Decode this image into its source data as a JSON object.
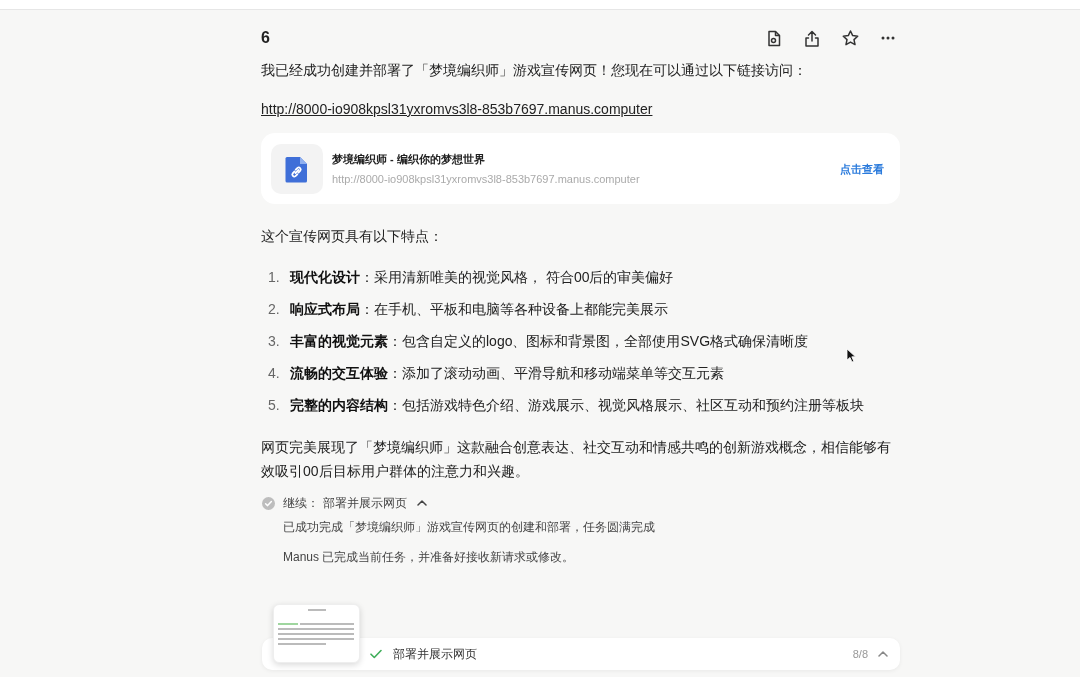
{
  "message": {
    "title": "6",
    "intro": "我已经成功创建并部署了「梦境编织师」游戏宣传网页！您现在可以通过以下链接访问：",
    "link": "http://8000-io908kpsl31yxromvs3l8-853b7697.manus.computer"
  },
  "link_card": {
    "title": "梦境编织师 - 编织你的梦想世界",
    "url": "http://8000-io908kpsl31yxromvs3l8-853b7697.manus.computer",
    "action": "点击查看"
  },
  "features_heading": "这个宣传网页具有以下特点：",
  "features": [
    {
      "number": "1.",
      "text": "**现代化设计**：采用清新唯美的视觉风格， 符合00后的审美偏好"
    },
    {
      "number": "2.",
      "text": "**响应式布局**：在手机、平板和电脑等各种设备上都能完美展示"
    },
    {
      "number": "3.",
      "text": "**丰富的视觉元素**：包含自定义的logo、图标和背景图，全部使用SVG格式确保清晰度"
    },
    {
      "number": "4.",
      "text": "**流畅的交互体验**：添加了滚动动画、平滑导航和移动端菜单等交互元素"
    },
    {
      "number": "5.",
      "text": "**完整的内容结构**：包括游戏特色介绍、游戏展示、视觉风格展示、社区互动和预约注册等板块"
    }
  ],
  "conclusion": "网页完美展现了「梦境编织师」这款融合创意表达、社交互动和情感共鸣的创新游戏概念，相信能够有效吸引00后目标用户群体的注意力和兴趣。",
  "step": {
    "label": "继续：",
    "title": "部署并展示网页",
    "completed": true,
    "expanded": true,
    "details": [
      "已成功完成「梦境编织师」游戏宣传网页的创建和部署，任务圆满完成",
      "Manus 已完成当前任务，并准备好接收新请求或修改。"
    ]
  },
  "bottom_bar": {
    "title": "部署并展示网页",
    "done": true,
    "progress": "8/8"
  }
}
